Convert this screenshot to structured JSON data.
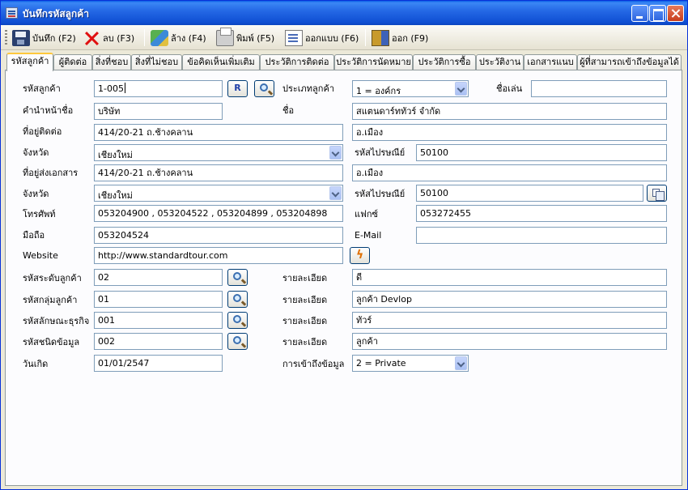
{
  "window": {
    "title": "บันทึกรหัสลูกค้า",
    "icon": "document-icon"
  },
  "toolbar": {
    "save_label": "บันทึก (F2)",
    "delete_label": "ลบ (F3)",
    "clear_label": "ล้าง (F4)",
    "print_label": "พิมพ์ (F5)",
    "form_label": "ออกแบบ (F6)",
    "exit_label": "ออก (F9)"
  },
  "tabs": [
    "รหัสลูกค้า",
    "ผู้ติดต่อ",
    "สิ่งที่ชอบ",
    "สิ่งที่ไม่ชอบ",
    "ข้อคิดเห็นเพิ่มเติม",
    "ประวัติการติดต่อ",
    "ประวัติการนัดหมาย",
    "ประวัติการซื้อ",
    "ประวัติงาน",
    "เอกสารแนบ",
    "ผู้ที่สามารถเข้าถึงข้อมูลได้"
  ],
  "active_tab": 0,
  "form": {
    "customer_code_label": "รหัสลูกค้า",
    "customer_code": "1-005",
    "r_button": "R",
    "customer_type_label": "ประเภทลูกค้า",
    "customer_type": "1 = องค์กร",
    "nickname_label": "ชื่อเล่น",
    "nickname": "",
    "prefix_label": "คำนำหน้าชื่อ",
    "prefix": "บริษัท",
    "name_label": "ชื่อ",
    "name": "สแตนดาร์ททัวร์ จำกัด",
    "contact_address_label": "ที่อยู่ติดต่อ",
    "contact_address1": "414/20-21 ถ.ช้างคลาน",
    "contact_address2": "อ.เมือง",
    "province_label": "จังหวัด",
    "province1": "เชียงใหม่",
    "postcode_label": "รหัสไปรษณีย์",
    "postcode1": "50100",
    "doc_address_label": "ที่อยู่ส่งเอกสาร",
    "doc_address1": "414/20-21 ถ.ช้างคลาน",
    "doc_address2": "อ.เมือง",
    "province2": "เชียงใหม่",
    "postcode2": "50100",
    "phone_label": "โทรศัพท์",
    "phone": "053204900 , 053204522 , 053204899  , 053204898",
    "fax_label": "แฟกซ์",
    "fax": "053272455",
    "mobile_label": "มือถือ",
    "mobile": "053204524",
    "email_label": "E-Mail",
    "email": "",
    "website_label": "Website",
    "website": "http://www.standardtour.com",
    "level_code_label": "รหัสระดับลูกค้า",
    "level_code": "02",
    "detail_label": "รายละเอียด",
    "level_detail": "ดี",
    "group_code_label": "รหัสกลุ่มลูกค้า",
    "group_code": "01",
    "group_detail": "ลูกค้า Devlop",
    "business_code_label": "รหัสลักษณะธุรกิจ",
    "business_code": "001",
    "business_detail": "ทัวร์",
    "datatype_code_label": "รหัสชนิดข้อมูล",
    "datatype_code": "002",
    "datatype_detail": "ลูกค้า",
    "birthdate_label": "วันเกิด",
    "birthdate": "01/01/2547",
    "access_label": "การเข้าถึงข้อมูล",
    "access": "2 = Private"
  }
}
